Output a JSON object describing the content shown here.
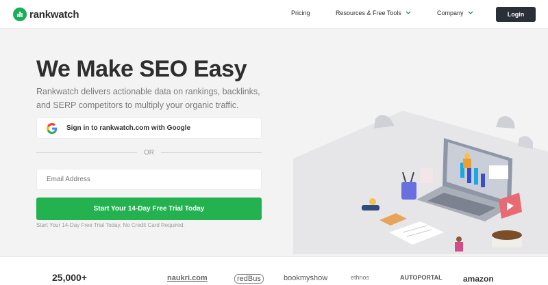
{
  "brand": {
    "name": "rankwatch"
  },
  "nav": {
    "pricing": "Pricing",
    "resources": "Resources & Free Tools",
    "company": "Company",
    "login": "Login"
  },
  "hero": {
    "title": "We Make SEO Easy",
    "subtitle": "Rankwatch delivers actionable data on rankings, backlinks, and SERP competitors to multiply your organic traffic.",
    "google_button": "Sign in to rankwatch.com with Google",
    "or_text": "OR",
    "email_placeholder": "Email Address",
    "trial_button": "Start Your 14-Day Free Trial Today",
    "trial_note": "Start Your 14-Day Free Trial Today. No Credit Card Required."
  },
  "strip": {
    "count": "25,000+",
    "brands": [
      "naukri.com",
      "redBus",
      "bookmyshow",
      "ethnos",
      "AUTOPORTAL",
      "amazon"
    ]
  },
  "colors": {
    "accent_green": "#23b24f",
    "login_bg": "#2b2f38",
    "hero_bg": "#f3f3f3"
  },
  "icons": {
    "logo": "rankwatch-logo-icon",
    "google": "google-g-icon",
    "chevron": "chevron-down-icon"
  }
}
